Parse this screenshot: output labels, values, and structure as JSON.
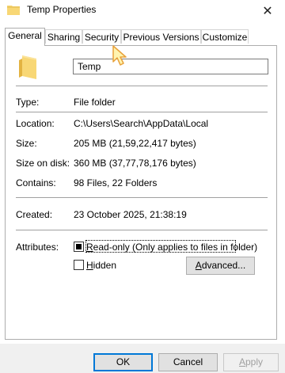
{
  "window": {
    "title": "Temp Properties",
    "close_glyph": "✕"
  },
  "tabs": [
    {
      "label": "General",
      "active": true
    },
    {
      "label": "Sharing",
      "active": false
    },
    {
      "label": "Security",
      "active": false
    },
    {
      "label": "Previous Versions",
      "active": false
    },
    {
      "label": "Customize",
      "active": false
    }
  ],
  "folder": {
    "icon": "folder-icon",
    "name_value": "Temp"
  },
  "properties": {
    "type_label": "Type:",
    "type_value": "File folder",
    "location_label": "Location:",
    "location_value": "C:\\Users\\Search\\AppData\\Local",
    "size_label": "Size:",
    "size_value": "205 MB (21,59,22,417 bytes)",
    "size_on_disk_label": "Size on disk:",
    "size_on_disk_value": "360 MB (37,77,78,176 bytes)",
    "contains_label": "Contains:",
    "contains_value": "98 Files, 22 Folders",
    "created_label": "Created:",
    "created_value": "23 October 2025, 21:38:19"
  },
  "attributes": {
    "label": "Attributes:",
    "readonly_prefix": "R",
    "readonly_rest": "ead-only (Only applies to files in folder)",
    "readonly_state": "indeterminate",
    "hidden_prefix": "H",
    "hidden_rest": "idden",
    "hidden_checked": false,
    "advanced_prefix": "A",
    "advanced_rest": "dvanced..."
  },
  "buttons": {
    "ok": "OK",
    "cancel": "Cancel",
    "apply_prefix": "A",
    "apply_rest": "pply",
    "apply_enabled": false
  },
  "colors": {
    "folder_yellow": "#f8d775",
    "default_button_border": "#0078d7",
    "cursor_fill": "#fff4b0"
  }
}
